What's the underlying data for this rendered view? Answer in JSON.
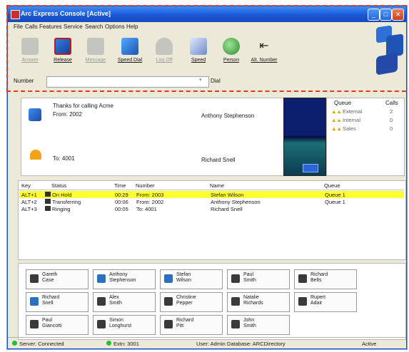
{
  "window": {
    "title": "Arc Express Console [Active]"
  },
  "menu": [
    "File",
    "Calls",
    "Features",
    "Service",
    "Search",
    "Options",
    "Help"
  ],
  "toolbar": {
    "buttons": [
      {
        "label": "Answer",
        "enabled": false
      },
      {
        "label": "Release",
        "enabled": true
      },
      {
        "label": "Message",
        "enabled": false
      },
      {
        "label": "Speed Dial",
        "enabled": true
      },
      {
        "label": "Log Off",
        "enabled": false
      },
      {
        "label": "Speed",
        "enabled": true
      },
      {
        "label": "Person",
        "enabled": true
      },
      {
        "label": "Alt. Number",
        "enabled": true
      }
    ]
  },
  "number_row": {
    "label": "Number",
    "dial_label": "Dial",
    "value": ""
  },
  "current_call": {
    "greeting": "Thanks for calling Acme",
    "from": "From: 2002",
    "from_name": "Anthony Stephenson",
    "to": "To: 4001",
    "to_name": "Richard Snell"
  },
  "queues": {
    "headers": [
      "Queue",
      "Calls"
    ],
    "rows": [
      {
        "name": "External",
        "calls": "2"
      },
      {
        "name": "Internal",
        "calls": "0"
      },
      {
        "name": "Sales",
        "calls": "0"
      }
    ]
  },
  "calls": {
    "headers": [
      "Key",
      "Status",
      "Time",
      "Number",
      "Name",
      "Queue"
    ],
    "rows": [
      {
        "key": "ALT+1",
        "status": "On Hold",
        "time": "00:29",
        "number": "From: 2003",
        "name": "Stefan Wilson",
        "queue": "Queue 1"
      },
      {
        "key": "ALT+2",
        "status": "Transferring",
        "time": "00:06",
        "number": "From: 2002",
        "name": "Anthony Stephenson",
        "queue": "Queue 1"
      },
      {
        "key": "ALT+3",
        "status": "Ringing",
        "time": "00:05",
        "number": "To: 4001",
        "name": "Richard Snell",
        "queue": ""
      }
    ]
  },
  "speed_dials": [
    {
      "name": "Gareth\nCase",
      "icon": "phone-icon"
    },
    {
      "name": "Anthony\nStephenson",
      "icon": "phone-blue-icon"
    },
    {
      "name": "Stefan\nWilson",
      "icon": "phone-blue-icon"
    },
    {
      "name": "Paul\nSmith",
      "icon": "phone-icon"
    },
    {
      "name": "Richard\nBelts",
      "icon": "phone-icon"
    },
    {
      "name": "Richard\nSnell",
      "icon": "phone-blue-icon"
    },
    {
      "name": "Alex\nSmith",
      "icon": "phone-icon"
    },
    {
      "name": "Christine\nPepper",
      "icon": "phone-icon"
    },
    {
      "name": "Natalie\nRichards",
      "icon": "phone-icon"
    },
    {
      "name": "Rupert\nAdair",
      "icon": "phone-icon"
    },
    {
      "name": "Paul\nGiancotti",
      "icon": "phone-icon"
    },
    {
      "name": "Simon\nLonghurst",
      "icon": "phone-icon"
    },
    {
      "name": "Richard\nPitt",
      "icon": "phone-icon"
    },
    {
      "name": "John\nSmith",
      "icon": "phone-icon"
    }
  ],
  "status_bar": {
    "server": "Server: Connected",
    "extn": "Extn: 3001",
    "user": "User: Admin  Database: ARCDirectory",
    "state": "Active"
  },
  "colors": {
    "highlight": "#ffff33",
    "title": "#1b58d6",
    "annotation": "#e03a1c"
  }
}
